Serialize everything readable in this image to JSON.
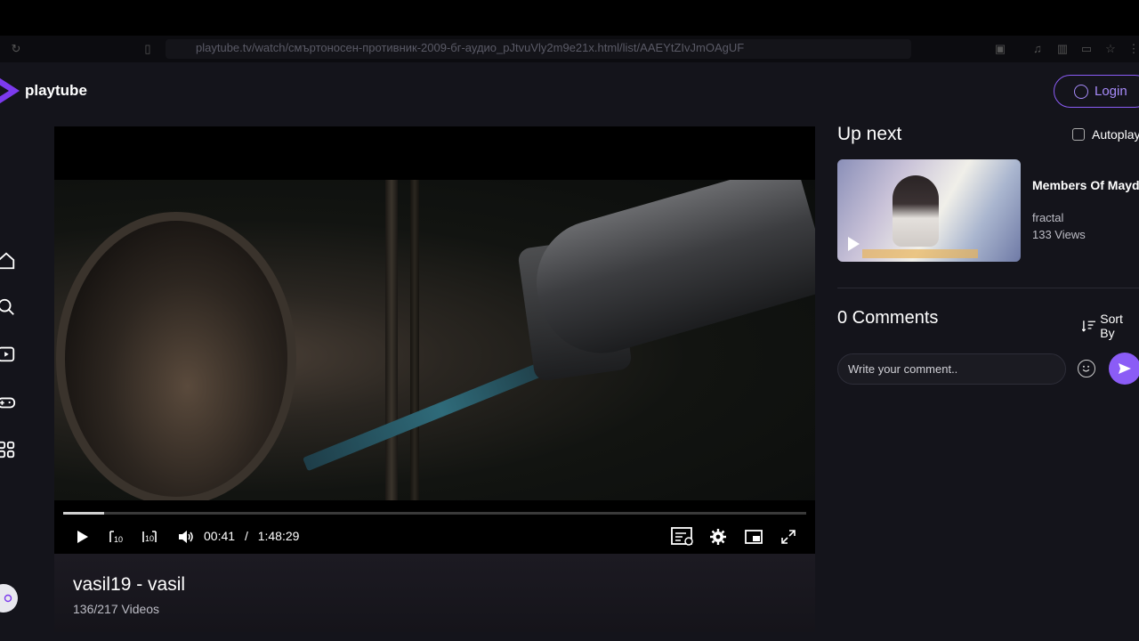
{
  "browser": {
    "url": "playtube.tv/watch/смъртоносен-противник-2009-бг-аудио_pJtvuVly2m9e21x.html/list/AAEYtZIvJmOAgUF"
  },
  "header": {
    "logo_text": "playtube",
    "login_label": "Login"
  },
  "sidebar": {
    "items": [
      {
        "icon": "home-icon"
      },
      {
        "icon": "search-icon"
      },
      {
        "icon": "subscriptions-icon"
      },
      {
        "icon": "gaming-icon"
      },
      {
        "icon": "categories-icon"
      }
    ]
  },
  "player": {
    "current_time": "00:41",
    "separator": "/",
    "duration": "1:48:29",
    "progress_fraction": 0.0063
  },
  "video": {
    "title": "vasil19 - vasil",
    "playlist_count": "136/217 Videos"
  },
  "up_next": {
    "heading": "Up next",
    "autoplay_label": "Autoplay",
    "items": [
      {
        "title": "Members Of Mayday - We Ar...",
        "channel": "fractal",
        "views": "133 Views"
      }
    ]
  },
  "comments": {
    "heading": "0 Comments",
    "sort_label": "Sort By",
    "input_placeholder": "Write your comment.."
  },
  "colors": {
    "accent": "#8b5cf6",
    "background": "#14141b"
  }
}
